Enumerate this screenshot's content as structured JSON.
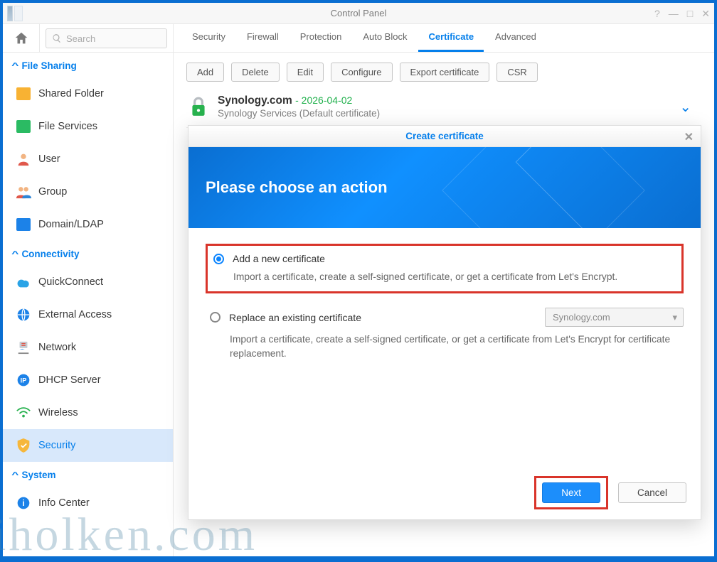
{
  "window": {
    "title": "Control Panel"
  },
  "search": {
    "placeholder": "Search"
  },
  "tabs": [
    {
      "label": "Security"
    },
    {
      "label": "Firewall"
    },
    {
      "label": "Protection"
    },
    {
      "label": "Auto Block"
    },
    {
      "label": "Certificate",
      "active": true
    },
    {
      "label": "Advanced"
    }
  ],
  "toolbar": {
    "add": "Add",
    "delete": "Delete",
    "edit": "Edit",
    "configure": "Configure",
    "export": "Export certificate",
    "csr": "CSR"
  },
  "sidebar": {
    "section1": "File Sharing",
    "section2": "Connectivity",
    "section3": "System",
    "items": {
      "shared": "Shared Folder",
      "file": "File Services",
      "user": "User",
      "group": "Group",
      "domain": "Domain/LDAP",
      "quick": "QuickConnect",
      "ext": "External Access",
      "net": "Network",
      "dhcp": "DHCP Server",
      "wifi": "Wireless",
      "sec": "Security",
      "info": "Info Center"
    }
  },
  "cert_entry": {
    "name": "Synology.com",
    "expires": "2026-04-02",
    "desc": "Synology Services (Default certificate)"
  },
  "dialog": {
    "title": "Create certificate",
    "heading": "Please choose an action",
    "opt1": {
      "label": "Add a new certificate",
      "desc": "Import a certificate, create a self-signed certificate, or get a certificate from Let's Encrypt."
    },
    "opt2": {
      "label": "Replace an existing certificate",
      "desc": "Import a certificate, create a self-signed certificate, or get a certificate from Let's Encrypt for certificate replacement.",
      "selected": "Synology.com"
    },
    "next": "Next",
    "cancel": "Cancel"
  },
  "watermark": "iholken.com"
}
